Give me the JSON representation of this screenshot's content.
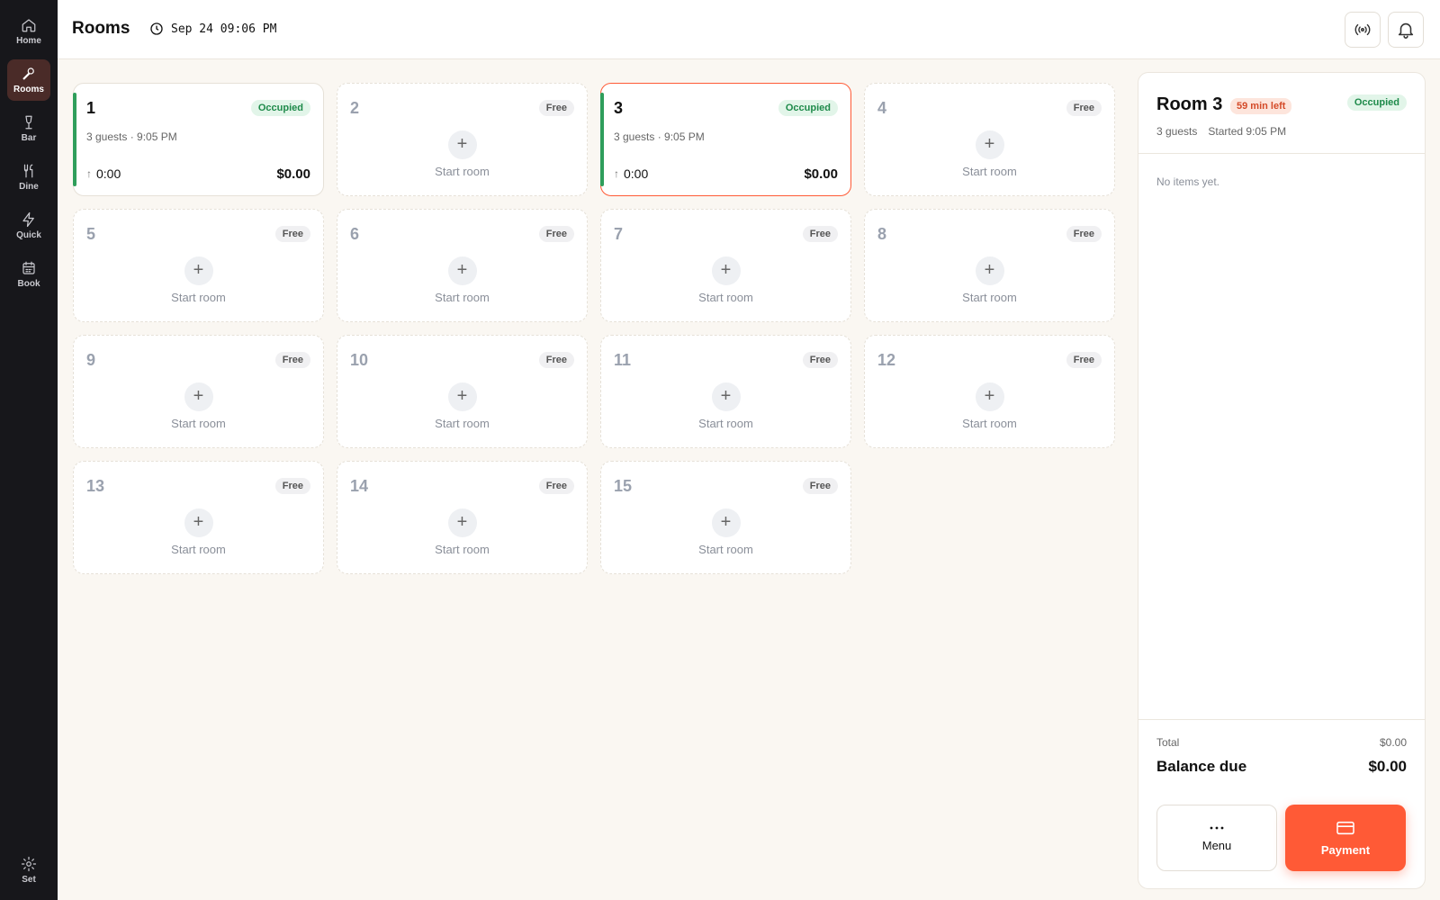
{
  "sidebar": {
    "items": [
      {
        "label": "Home",
        "icon": "home-icon"
      },
      {
        "label": "Rooms",
        "icon": "microphone-icon",
        "active": true
      },
      {
        "label": "Bar",
        "icon": "wine-glass-icon"
      },
      {
        "label": "Dine",
        "icon": "fork-knife-icon"
      },
      {
        "label": "Quick",
        "icon": "lightning-icon"
      },
      {
        "label": "Book",
        "icon": "calendar-icon"
      }
    ],
    "settings_label": "Set"
  },
  "header": {
    "title": "Rooms",
    "datetime": "Sep 24 09:06 PM",
    "icons": [
      "broadcast-icon",
      "bell-icon"
    ]
  },
  "rooms": [
    {
      "number": "1",
      "status": "Occupied",
      "guests": "3 guests · 9:05 PM",
      "timer": "0:00",
      "amount": "$0.00"
    },
    {
      "number": "2",
      "status": "Free",
      "action": "Start room"
    },
    {
      "number": "3",
      "status": "Occupied",
      "guests": "3 guests · 9:05 PM",
      "timer": "0:00",
      "amount": "$0.00",
      "selected": true
    },
    {
      "number": "4",
      "status": "Free",
      "action": "Start room"
    },
    {
      "number": "5",
      "status": "Free",
      "action": "Start room"
    },
    {
      "number": "6",
      "status": "Free",
      "action": "Start room"
    },
    {
      "number": "7",
      "status": "Free",
      "action": "Start room"
    },
    {
      "number": "8",
      "status": "Free",
      "action": "Start room"
    },
    {
      "number": "9",
      "status": "Free",
      "action": "Start room"
    },
    {
      "number": "10",
      "status": "Free",
      "action": "Start room"
    },
    {
      "number": "11",
      "status": "Free",
      "action": "Start room"
    },
    {
      "number": "12",
      "status": "Free",
      "action": "Start room"
    },
    {
      "number": "13",
      "status": "Free",
      "action": "Start room"
    },
    {
      "number": "14",
      "status": "Free",
      "action": "Start room"
    },
    {
      "number": "15",
      "status": "Free",
      "action": "Start room"
    }
  ],
  "panel": {
    "title": "Room 3",
    "time_left": "59 min left",
    "status": "Occupied",
    "guests": "3 guests",
    "started": "Started 9:05 PM",
    "empty_text": "No items yet.",
    "total_label": "Total",
    "total_value": "$0.00",
    "balance_label": "Balance due",
    "balance_value": "$0.00",
    "menu_label": "Menu",
    "payment_label": "Payment"
  },
  "colors": {
    "accent": "#ff5a36",
    "sidebar_bg": "#17171b",
    "active_nav_bg": "#4a2b28",
    "occupied_green": "#2f9e5b"
  }
}
